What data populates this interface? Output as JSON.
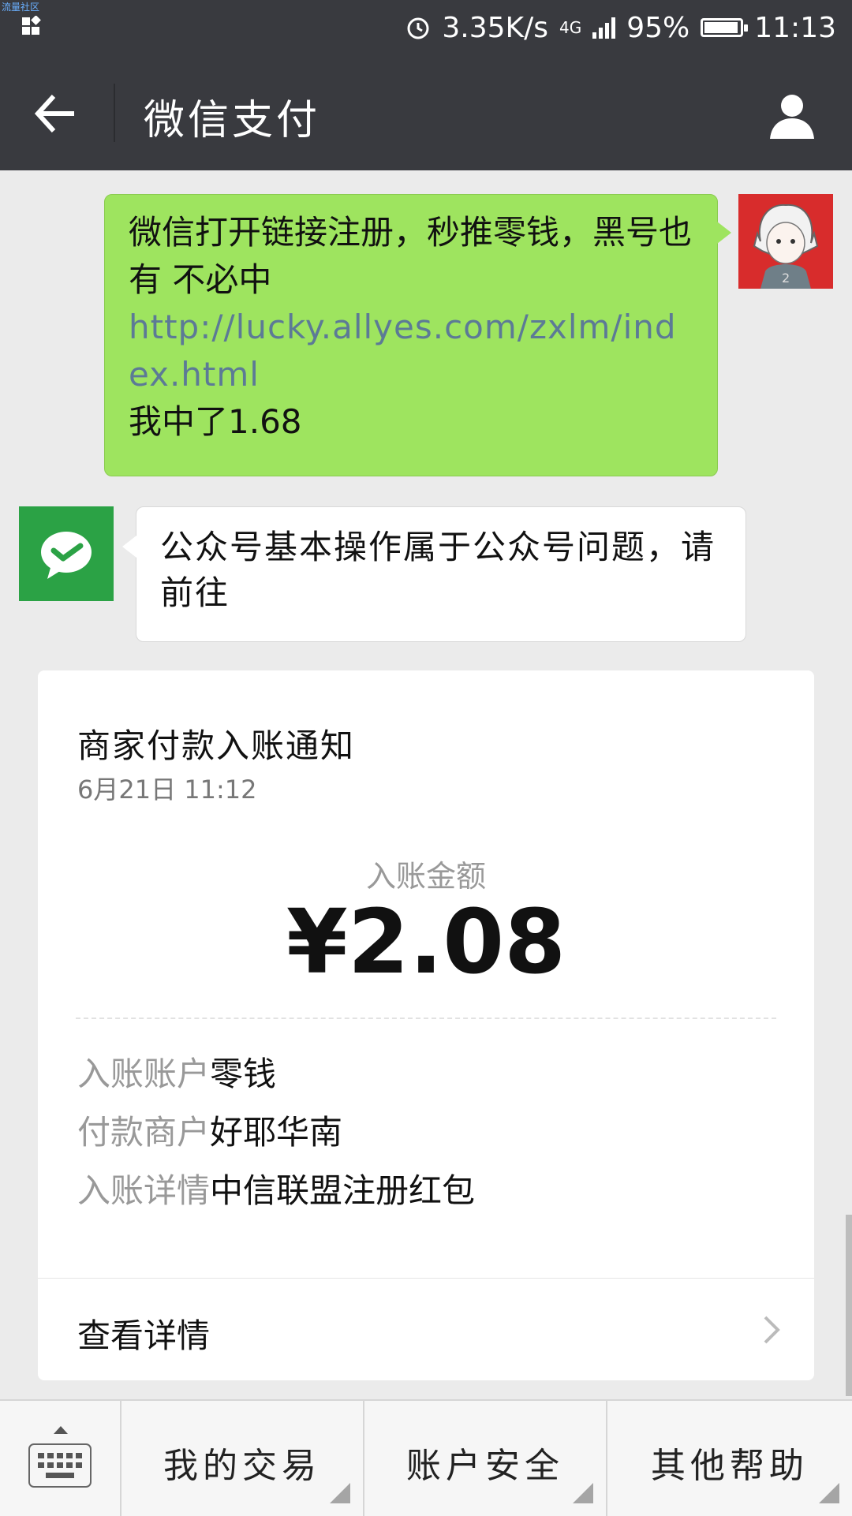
{
  "statusbar": {
    "watermark": "流量社区",
    "net_speed": "3.35K/s",
    "network_type": "4G",
    "battery_text": "95%",
    "battery_level": 0.95,
    "time": "11:13"
  },
  "navbar": {
    "title": "微信支付"
  },
  "messages": {
    "user_text_1": "微信打开链接注册，秒推零钱，黑号也有 不必中",
    "user_link": "http://lucky.allyes.com/zxlm/index.html",
    "user_text_2": "我中了1.68",
    "reply_text": "公众号基本操作属于公众号问题，请前往"
  },
  "card": {
    "title": "商家付款入账通知",
    "date": "6月21日 11:12",
    "amount_label": "入账金额",
    "amount": "¥2.08",
    "rows": [
      {
        "key": "入账账户",
        "value": "零钱"
      },
      {
        "key": "付款商户",
        "value": "好耶华南"
      },
      {
        "key": "入账详情",
        "value": "中信联盟注册红包"
      }
    ],
    "details_label": "查看详情"
  },
  "bottom_menu": {
    "items": [
      {
        "label": "我的交易"
      },
      {
        "label": "账户安全"
      },
      {
        "label": "其他帮助"
      }
    ]
  },
  "colors": {
    "header_bg": "#393a3f",
    "chat_bg": "#ebebeb",
    "bubble_green": "#9ee45f",
    "wechat_pay_green": "#2ba245",
    "link": "#5c7a96"
  }
}
